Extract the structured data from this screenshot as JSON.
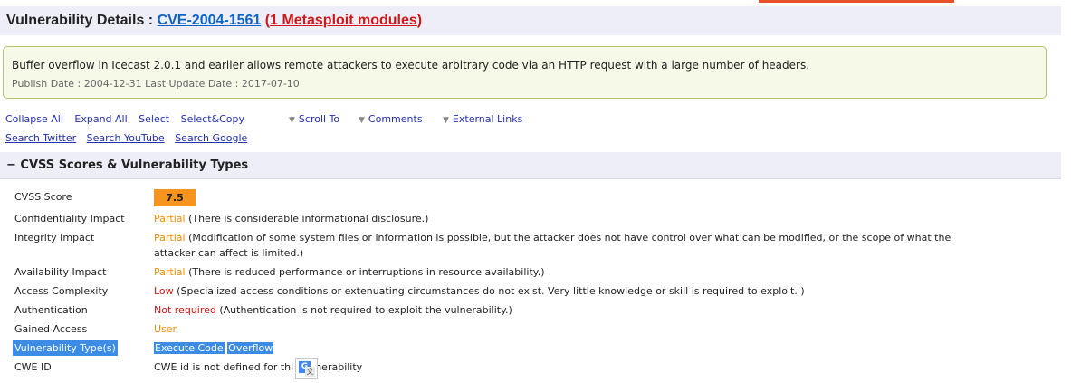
{
  "header": {
    "title_prefix": "Vulnerability Details : ",
    "cve_id": "CVE-2004-1561",
    "paren_open": "(",
    "metasploit_link": "1 Metasploit modules",
    "paren_close": ")"
  },
  "summary": {
    "description": "Buffer overflow in Icecast 2.0.1 and earlier allows remote attackers to execute arbitrary code via an HTTP request with a large number of headers.",
    "dates": "Publish Date : 2004-12-31 Last Update Date : 2017-07-10"
  },
  "actions": {
    "collapse_all": "Collapse All",
    "expand_all": "Expand All",
    "select": "Select",
    "select_copy": "Select&Copy",
    "scroll_to": "Scroll To",
    "comments": "Comments",
    "external_links": "External Links",
    "search_twitter": "Search Twitter",
    "search_youtube": "Search YouTube",
    "search_google": "Search Google"
  },
  "section": {
    "title": "− CVSS Scores & Vulnerability Types"
  },
  "cvss": {
    "score_label": "CVSS Score",
    "score": "7.5",
    "confidentiality_label": "Confidentiality Impact",
    "confidentiality_value": "Partial",
    "confidentiality_desc": " (There is considerable informational disclosure.)",
    "integrity_label": "Integrity Impact",
    "integrity_value": "Partial",
    "integrity_desc": " (Modification of some system files or information is possible, but the attacker does not have control over what can be modified, or the scope of what the attacker can affect is limited.)",
    "availability_label": "Availability Impact",
    "availability_value": "Partial",
    "availability_desc": " (There is reduced performance or interruptions in resource availability.)",
    "access_complexity_label": "Access Complexity",
    "access_complexity_value": "Low",
    "access_complexity_desc": " (Specialized access conditions or extenuating circumstances do not exist. Very little knowledge or skill is required to exploit. )",
    "authentication_label": "Authentication",
    "authentication_value": "Not required",
    "authentication_desc": " (Authentication is not required to exploit the vulnerability.)",
    "gained_access_label": "Gained Access",
    "gained_access_value": "User",
    "vuln_type_label": "Vulnerability Type(s)",
    "vuln_type_1": "Execute Code",
    "vuln_type_2": "Overflow",
    "cwe_label": "CWE ID",
    "cwe_value_start": "CWE id is not defined for thi",
    "cwe_value_end": "nerability"
  },
  "colors": {
    "accent_orange": "#f7941d",
    "link_blue": "#0a64c8",
    "link_red": "#d01818",
    "selection_blue": "#3c8ce6"
  },
  "icons": {
    "translate": "google-translate-icon",
    "dropdown": "triangle-down-icon"
  }
}
